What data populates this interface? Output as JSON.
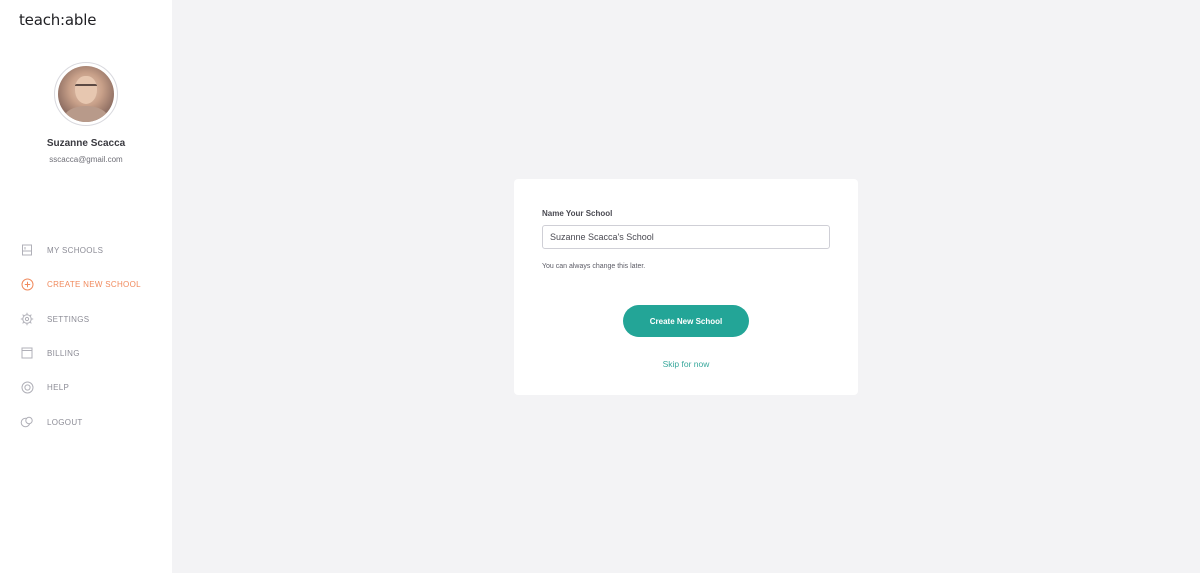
{
  "brand": {
    "logo_text": "teach:able"
  },
  "user": {
    "name": "Suzanne Scacca",
    "email": "sscacca@gmail.com"
  },
  "sidebar": {
    "items": [
      {
        "label": "MY SCHOOLS",
        "icon": "schools-icon",
        "active": false
      },
      {
        "label": "CREATE NEW SCHOOL",
        "icon": "plus-circle-icon",
        "active": true
      },
      {
        "label": "SETTINGS",
        "icon": "gear-icon",
        "active": false
      },
      {
        "label": "BILLING",
        "icon": "billing-icon",
        "active": false
      },
      {
        "label": "HELP",
        "icon": "help-icon",
        "active": false
      },
      {
        "label": "LOGOUT",
        "icon": "logout-icon",
        "active": false
      }
    ]
  },
  "form": {
    "label": "Name Your School",
    "value": "Suzanne Scacca's School",
    "hint": "You can always change this later.",
    "submit_label": "Create New School",
    "skip_label": "Skip for now"
  },
  "colors": {
    "accent": "#23a597",
    "active_nav": "#f08a5d",
    "background": "#f3f3f5"
  }
}
